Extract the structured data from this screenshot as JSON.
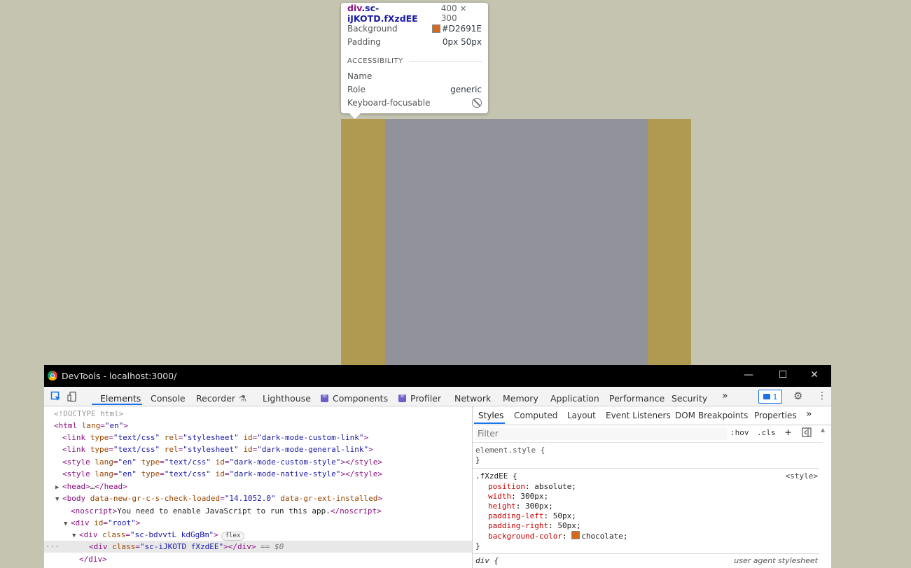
{
  "tooltip": {
    "tag": "div",
    "classes": ".sc-iJKOTD.fXzdEE",
    "dimensions": "400 × 300",
    "rows": [
      {
        "label": "Background",
        "value": "#D2691E",
        "color": "#D2691E"
      },
      {
        "label": "Padding",
        "value": "0px 50px"
      }
    ],
    "accessibility_heading": "ACCESSIBILITY",
    "a11y": [
      {
        "label": "Name",
        "value": ""
      },
      {
        "label": "Role",
        "value": "generic"
      },
      {
        "label": "Keyboard-focusable",
        "icon": "not-allowed-icon"
      }
    ]
  },
  "overlay": {
    "padding_color": "#b09a52",
    "content_color": "#92929b"
  },
  "window": {
    "title": "DevTools - localhost:3000/",
    "controls": [
      "—",
      "☐",
      "✕"
    ]
  },
  "tabs": [
    {
      "label": "Elements",
      "active": true
    },
    {
      "label": "Console"
    },
    {
      "label": "Recorder"
    },
    {
      "label": "Lighthouse"
    },
    {
      "label": "Components",
      "icon": "react-icon"
    },
    {
      "label": "Profiler",
      "icon": "react-icon"
    },
    {
      "label": "Network"
    },
    {
      "label": "Memory"
    },
    {
      "label": "Application"
    },
    {
      "label": "Performance"
    },
    {
      "label": "Security"
    }
  ],
  "more_tabs": "»",
  "issues_badge": "1",
  "dom": [
    {
      "kind": "comment",
      "text": "<!DOCTYPE html>"
    },
    {
      "kind": "open",
      "text": "<html lang=\"en\">"
    },
    {
      "kind": "node",
      "text": "<link type=\"text/css\" rel=\"stylesheet\" id=\"dark-mode-custom-link\">"
    },
    {
      "kind": "node",
      "text": "<link type=\"text/css\" rel=\"stylesheet\" id=\"dark-mode-general-link\">"
    },
    {
      "kind": "node",
      "text": "<style lang=\"en\" type=\"text/css\" id=\"dark-mode-custom-style\"></style>"
    },
    {
      "kind": "node",
      "text": "<style lang=\"en\" type=\"text/css\" id=\"dark-mode-native-style\"></style>"
    },
    {
      "kind": "collapsed",
      "text": "<head>…</head>"
    },
    {
      "kind": "open",
      "text": "<body data-new-gr-c-s-check-loaded=\"14.1052.0\" data-gr-ext-installed>"
    },
    {
      "kind": "node",
      "text": "<noscript>You need to enable JavaScript to run this app.</noscript>"
    },
    {
      "kind": "open",
      "text": "<div id=\"root\">"
    },
    {
      "kind": "open",
      "text": "<div class=\"sc-bdvvtL kdGgBm\">",
      "pill": "flex"
    },
    {
      "kind": "selected",
      "text": "<div class=\"sc-iJKOTD fXzdEE\"></div>",
      "suffix": "== $0"
    },
    {
      "kind": "close",
      "text": "</div>"
    }
  ],
  "styles_tabs": [
    "Styles",
    "Computed",
    "Layout",
    "Event Listeners",
    "DOM Breakpoints",
    "Properties"
  ],
  "filter_placeholder": "Filter",
  "filter_buttons": [
    ":hov",
    ".cls",
    "+"
  ],
  "rules": {
    "element_style_selector": "element.style {",
    "close_brace": "}",
    "rule_selector": ".fXzdEE {",
    "rule_source": "<style>",
    "declarations": [
      {
        "prop": "position",
        "value": "absolute;"
      },
      {
        "prop": "width",
        "value": "300px;"
      },
      {
        "prop": "height",
        "value": "300px;"
      },
      {
        "prop": "padding-left",
        "value": "50px;"
      },
      {
        "prop": "padding-right",
        "value": "50px;"
      },
      {
        "prop": "background-color",
        "value": "chocolate;",
        "color": "#D2691E"
      }
    ],
    "ua_selector": "div {",
    "ua_source": "user agent stylesheet"
  }
}
